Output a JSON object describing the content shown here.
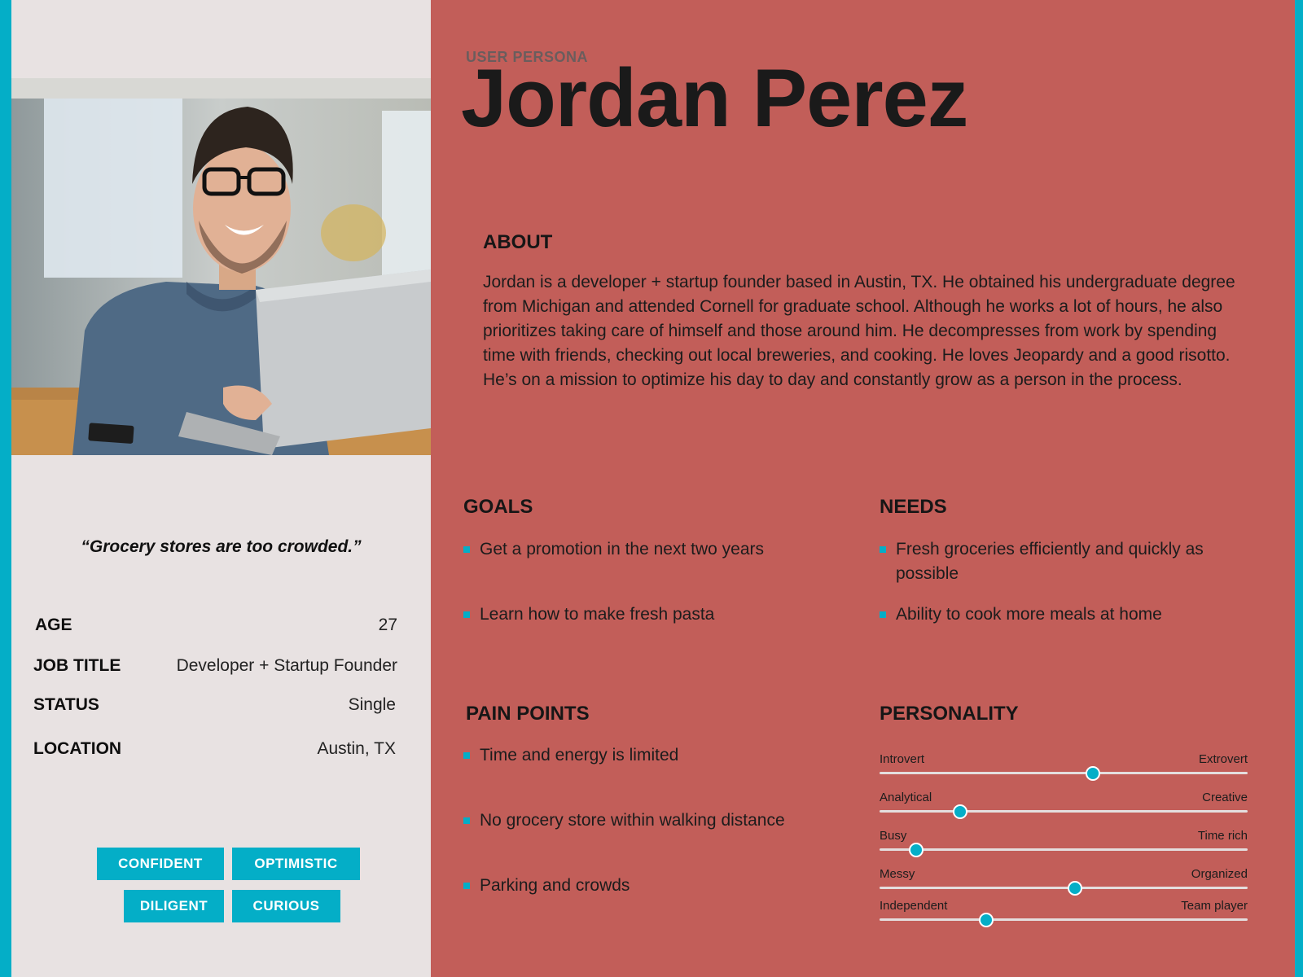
{
  "persona": {
    "subtitle": "USER PERSONA",
    "name": "Jordan Perez",
    "quote": "“Grocery stores are too crowded.”"
  },
  "info": {
    "age": {
      "label": "AGE",
      "value": "27"
    },
    "job": {
      "label": "JOB TITLE",
      "value": "Developer + Startup Founder"
    },
    "status": {
      "label": "STATUS",
      "value": "Single"
    },
    "location": {
      "label": "LOCATION",
      "value": "Austin, TX"
    }
  },
  "tags": [
    "CONFIDENT",
    "OPTIMISTIC",
    "DILIGENT",
    "CURIOUS"
  ],
  "about": {
    "heading": "ABOUT",
    "text": "Jordan is a developer + startup founder based in Austin, TX. He obtained his undergraduate degree from Michigan and attended Cornell for graduate school. Although he works a lot of hours, he also prioritizes taking care of himself and those around him. He decompresses from work by spending time with friends, checking out local breweries, and cooking. He loves Jeopardy and a good risotto. He’s on a mission to optimize his day to day and constantly grow as a person in the process."
  },
  "goals": {
    "heading": "GOALS",
    "items": [
      "Get a promotion in the next two years",
      "Learn how to make fresh pasta"
    ]
  },
  "needs": {
    "heading": "NEEDS",
    "items": [
      "Fresh groceries efficiently and quickly as possible",
      "Ability to cook more meals at home"
    ]
  },
  "pain_points": {
    "heading": "PAIN POINTS",
    "items": [
      "Time and energy is limited",
      "No grocery store within walking distance",
      "Parking and crowds"
    ]
  },
  "personality": {
    "heading": "PERSONALITY",
    "sliders": [
      {
        "left": "Introvert",
        "right": "Extrovert",
        "value": 0.58
      },
      {
        "left": "Analytical",
        "right": "Creative",
        "value": 0.22
      },
      {
        "left": "Busy",
        "right": "Time rich",
        "value": 0.1
      },
      {
        "left": "Messy",
        "right": "Organized",
        "value": 0.53
      },
      {
        "left": "Independent",
        "right": "Team player",
        "value": 0.29
      }
    ]
  },
  "colors": {
    "accent": "#04aec7",
    "background": "#c25e59",
    "panel": "#e8e2e2"
  }
}
